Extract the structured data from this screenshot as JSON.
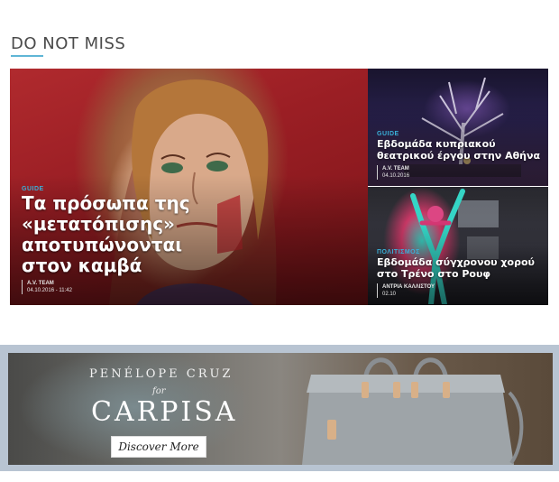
{
  "section": {
    "title": "DO NOT MISS"
  },
  "featured": [
    {
      "category": "GUIDE",
      "headline": "Τα πρόσωπα της «μετατόπισης» αποτυπώνονται στον καμβά",
      "author": "A.V. TEAM",
      "date": "04.10.2016 - 11:42",
      "image_icon": "portrait-painting-image"
    },
    {
      "category": "GUIDE",
      "headline": "Εβδομάδα κυπριακού θεατρικού έργου στην Αθήνα",
      "author": "A.V. TEAM",
      "date": "04.10.2016",
      "image_icon": "stage-tree-image"
    },
    {
      "category": "ΠΟΛΙΤΙΣΜΟΣ",
      "headline": "Εβδομάδα σύγχρονου χορού στο Τρένο στο Ρουφ",
      "author": "ΑΝΤΡΙΑ ΚΑΛΛΙΣΤΟΥ",
      "date": "02.10",
      "image_icon": "dancer-image"
    }
  ],
  "ad": {
    "brand_top": "PENÉLOPE CRUZ",
    "for": "for",
    "brand_main": "CARPISA",
    "cta": "Discover More",
    "image_icon": "handbag-image"
  },
  "colors": {
    "accent": "#3ab0d8",
    "underline": "#5fb6d6",
    "ad_frame": "#b8c4d2"
  }
}
